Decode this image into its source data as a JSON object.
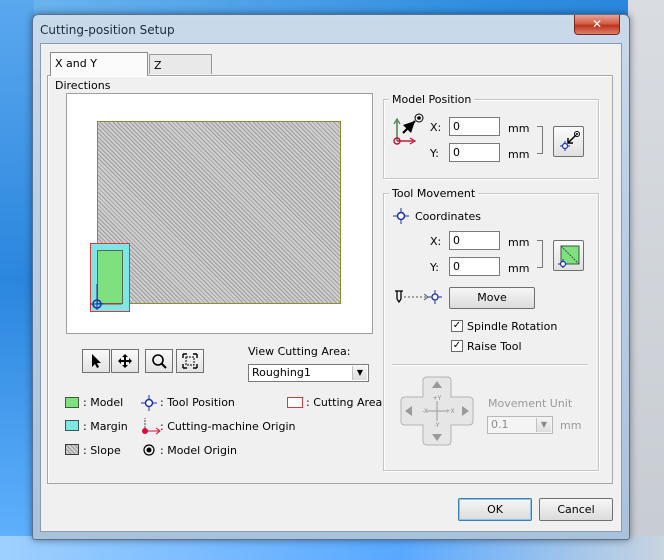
{
  "window": {
    "title": "Cutting-position Setup",
    "close_glyph": "✕"
  },
  "tabs": [
    {
      "label": "X and Y Directions",
      "active": true
    },
    {
      "label": "Z Direction",
      "active": false
    }
  ],
  "view_cutting_area": {
    "label": "View Cutting Area:",
    "value": "Roughing1"
  },
  "legend": {
    "model": ": Model",
    "margin": ": Margin",
    "slope": ": Slope",
    "tool_position": ": Tool Position",
    "cutting_machine_origin": ": Cutting-machine Origin",
    "model_origin": ": Model Origin",
    "cutting_area": ": Cutting Area"
  },
  "model_position": {
    "title": "Model Position",
    "x_label": "X:",
    "x_value": "0",
    "x_unit": "mm",
    "y_label": "Y:",
    "y_value": "0",
    "y_unit": "mm"
  },
  "tool_movement": {
    "title": "Tool Movement",
    "coordinates_label": "Coordinates",
    "x_label": "X:",
    "x_value": "0",
    "x_unit": "mm",
    "y_label": "Y:",
    "y_value": "0",
    "y_unit": "mm",
    "move_label": "Move",
    "spindle_rotation": {
      "label": "Spindle Rotation",
      "checked": true
    },
    "raise_tool": {
      "label": "Raise Tool",
      "checked": true
    },
    "movement_unit": {
      "label": "Movement Unit",
      "value": "0.1",
      "unit": "mm"
    },
    "pad": {
      "up": "+Y",
      "down": "-Y",
      "left": "-X",
      "right": "+X"
    }
  },
  "buttons": {
    "ok": "OK",
    "cancel": "Cancel"
  },
  "colors": {
    "model": "#7ee07e",
    "margin": "#7fe5e5",
    "cutting_area": "#d23c3c",
    "tool_position": "#1a2fa8",
    "machine_origin": "#d0103a"
  }
}
